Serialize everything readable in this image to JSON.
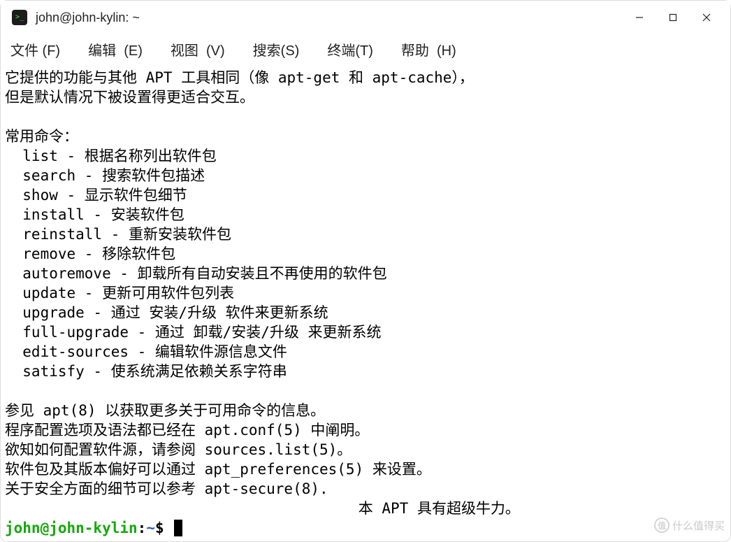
{
  "window": {
    "title": "john@john-kylin: ~"
  },
  "menubar": {
    "file": "文件 (F)",
    "edit": "编辑  (E)",
    "view": "视图  (V)",
    "search": "搜索(S)",
    "terminal": "终端(T)",
    "help": "帮助  (H)"
  },
  "terminal": {
    "lines": [
      "它提供的功能与其他 APT 工具相同（像 apt-get 和 apt-cache），",
      "但是默认情况下被设置得更适合交互。",
      "",
      "常用命令：",
      "  list - 根据名称列出软件包",
      "  search - 搜索软件包描述",
      "  show - 显示软件包细节",
      "  install - 安装软件包",
      "  reinstall - 重新安装软件包",
      "  remove - 移除软件包",
      "  autoremove - 卸载所有自动安装且不再使用的软件包",
      "  update - 更新可用软件包列表",
      "  upgrade - 通过 安装/升级 软件来更新系统",
      "  full-upgrade - 通过 卸载/安装/升级 来更新系统",
      "  edit-sources - 编辑软件源信息文件",
      "  satisfy - 使系统满足依赖关系字符串",
      "",
      "参见 apt(8) 以获取更多关于可用命令的信息。",
      "程序配置选项及语法都已经在 apt.conf(5) 中阐明。",
      "欲知如何配置软件源，请参阅 sources.list(5)。",
      "软件包及其版本偏好可以通过 apt_preferences(5) 来设置。",
      "关于安全方面的细节可以参考 apt-secure(8).",
      "                                        本 APT 具有超级牛力。"
    ],
    "prompt": {
      "userhost": "john@john-kylin",
      "sep": ":",
      "path": "~",
      "symbol": "$"
    }
  },
  "watermark": {
    "badge": "值",
    "text": "什么值得买"
  }
}
